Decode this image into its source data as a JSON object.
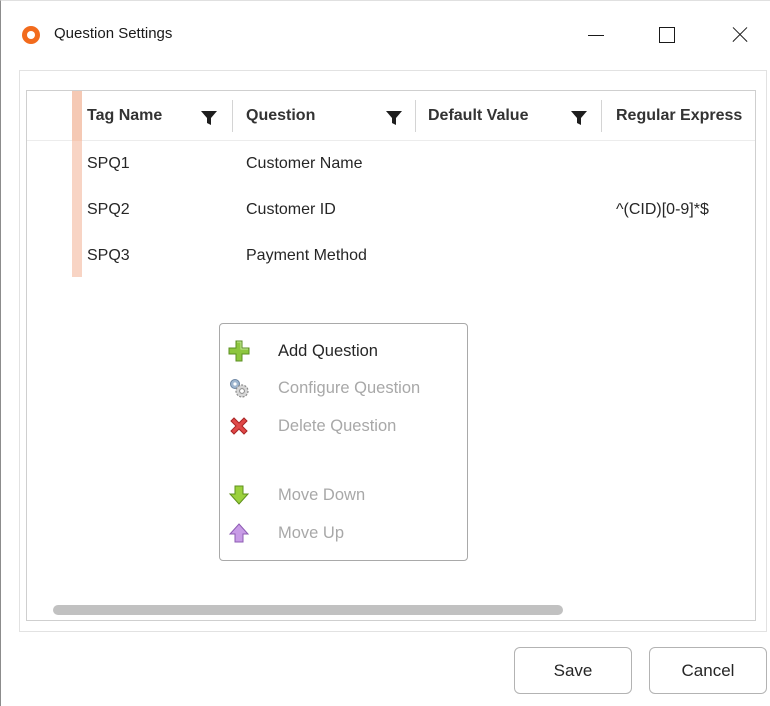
{
  "window": {
    "title": "Question Settings",
    "icon": "app-logo-icon",
    "accent": "#f26b1d"
  },
  "grid": {
    "columns": [
      {
        "label": "Tag Name",
        "filter_icon": "filter-icon"
      },
      {
        "label": "Question",
        "filter_icon": "filter-icon"
      },
      {
        "label": "Default Value",
        "filter_icon": "filter-icon"
      },
      {
        "label": "Regular Express"
      }
    ],
    "rows": [
      {
        "tag": "SPQ1",
        "question": "Customer Name",
        "default": "",
        "regex": ""
      },
      {
        "tag": "SPQ2",
        "question": "Customer ID",
        "default": "",
        "regex": "^(CID)[0-9]*$"
      },
      {
        "tag": "SPQ3",
        "question": "Payment Method",
        "default": "",
        "regex": ""
      }
    ]
  },
  "context_menu": {
    "items": [
      {
        "label": "Add Question",
        "icon": "add-plus-icon",
        "enabled": true
      },
      {
        "label": "Configure Question",
        "icon": "gears-icon",
        "enabled": false
      },
      {
        "label": "Delete Question",
        "icon": "delete-x-icon",
        "enabled": false
      },
      {
        "label": "Move Down",
        "icon": "arrow-down-icon",
        "enabled": false
      },
      {
        "label": "Move Up",
        "icon": "arrow-up-icon",
        "enabled": false
      }
    ]
  },
  "footer": {
    "save_label": "Save",
    "cancel_label": "Cancel"
  }
}
